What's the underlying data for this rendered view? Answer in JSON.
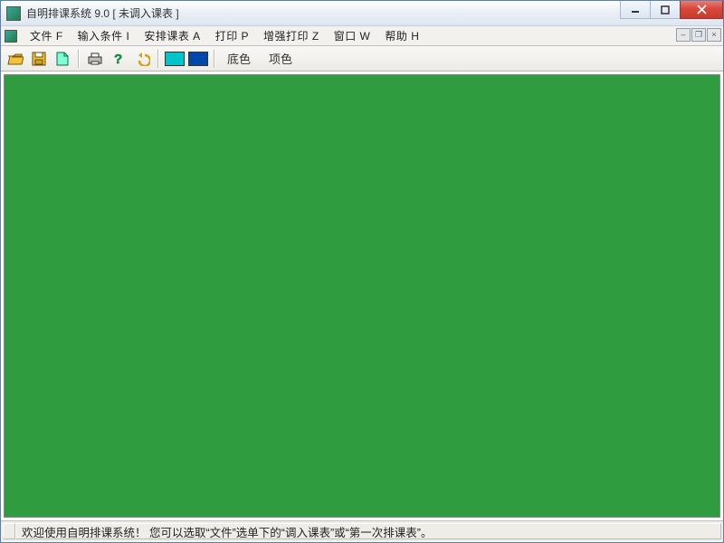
{
  "window": {
    "title": "自明排课系统 9.0 [ 未调入课表 ]"
  },
  "menu": {
    "items": [
      "文件 F",
      "输入条件 I",
      "安排课表 A",
      "打印 P",
      "增强打印 Z",
      "窗口 W",
      "帮助 H"
    ]
  },
  "toolbar": {
    "labels": {
      "bg": "底色",
      "item": "项色"
    },
    "icons": {
      "open": "open-icon",
      "save": "save-icon",
      "new": "new-icon",
      "print": "print-icon",
      "help": "help-icon",
      "undo": "undo-icon",
      "swatch_cyan": "swatch-cyan",
      "swatch_blue": "swatch-blue"
    }
  },
  "content": {
    "bg_color": "#2e9c3f"
  },
  "status": {
    "text": "欢迎使用自明排课系统！ 您可以选取“文件”选单下的“调入课表”或“第一次排课表”。"
  }
}
